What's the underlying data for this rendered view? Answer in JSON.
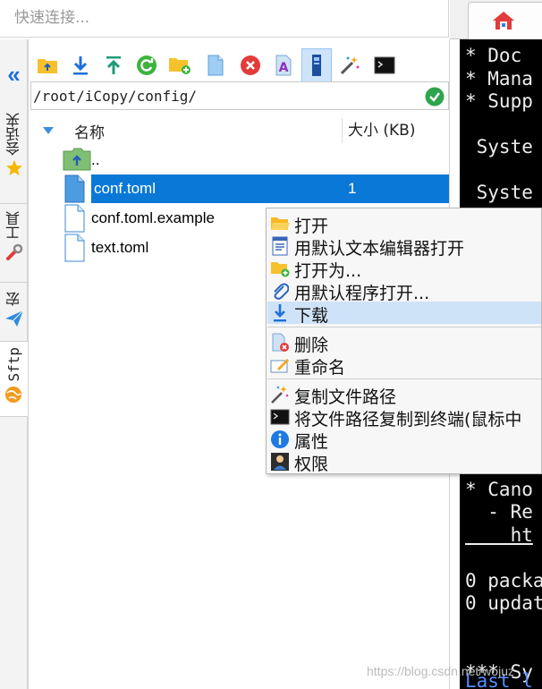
{
  "quick_connect": {
    "placeholder": "快速连接..."
  },
  "side_tabs": [
    {
      "label": "会话夹",
      "icon": "star-icon"
    },
    {
      "label": "工具",
      "icon": "tools-icon"
    },
    {
      "label": "宏",
      "icon": "paper-plane-icon"
    },
    {
      "label": "Sftp",
      "icon": "sftp-globe-icon"
    }
  ],
  "toolbar": {
    "buttons": [
      "parent-folder",
      "download",
      "upload",
      "refresh",
      "new-folder",
      "new-file",
      "delete",
      "rename",
      "toggle-view",
      "magic-wand",
      "terminal"
    ]
  },
  "path": {
    "value": "/root/iCopy/config/"
  },
  "file_list": {
    "columns": {
      "name": "名称",
      "size": "大小 (KB)"
    },
    "rows": [
      {
        "name": "..",
        "size": "",
        "type": "parent"
      },
      {
        "name": "conf.toml",
        "size": "1",
        "type": "file",
        "selected": true
      },
      {
        "name": "conf.toml.example",
        "size": "",
        "type": "file"
      },
      {
        "name": "text.toml",
        "size": "",
        "type": "file"
      }
    ]
  },
  "context_menu": {
    "items": [
      {
        "label": "打开",
        "icon": "folder-open-icon"
      },
      {
        "label": "用默认文本编辑器打开",
        "icon": "text-editor-icon"
      },
      {
        "label": "打开为...",
        "icon": "folder-add-icon"
      },
      {
        "label": "用默认程序打开...",
        "icon": "paperclip-icon"
      },
      {
        "label": "下载",
        "icon": "download-icon",
        "hover": true
      },
      {
        "label": "删除",
        "icon": "delete-file-icon"
      },
      {
        "label": "重命名",
        "icon": "rename-icon"
      },
      {
        "label": "复制文件路径",
        "icon": "magic-wand-icon"
      },
      {
        "label": "将文件路径复制到终端(鼠标中",
        "icon": "terminal-icon"
      },
      {
        "label": "属性",
        "icon": "info-icon"
      },
      {
        "label": "权限",
        "icon": "permissions-icon"
      }
    ]
  },
  "terminal": {
    "lines": [
      "* Doc",
      "* Mana",
      "* Supp",
      "",
      " Syste",
      "",
      " Syste",
      "",
      "",
      "",
      "",
      "",
      "",
      "",
      "",
      "",
      "",
      "",
      "",
      "* Cano",
      "  - Re",
      "    ht",
      "",
      "0 packa",
      "0 updat",
      "",
      "",
      "*** Sy"
    ],
    "last_line": "Last l"
  },
  "watermark": "https://blog.csdn.net/wojuz",
  "colors": {
    "selection": "#0a78d7",
    "menu_hover": "#cfe3f8",
    "accent": "#1e6fd9"
  }
}
